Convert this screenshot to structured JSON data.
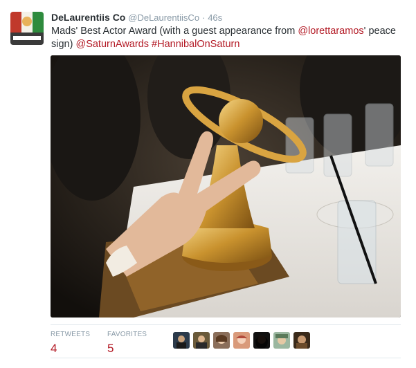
{
  "tweet": {
    "author_name": "DeLaurentiis Co",
    "author_handle": "@DeLaurentiisCo",
    "separator": "·",
    "timestamp": "46s",
    "text_part1": "Mads' Best Actor Award (with a guest appearance from ",
    "mention": "@lorettaramos",
    "text_part2": "' peace sign) ",
    "hashtag_saturn": "@SaturnAwards",
    "hashtag_hannibal": "#HannibalOnSaturn",
    "photo_icon": "saturn-award-photo"
  },
  "stats": {
    "retweets_label": "RETWEETS",
    "retweets_count": "4",
    "favorites_label": "FAVORITES",
    "favorites_count": "5"
  },
  "favoriters": [
    {
      "icon": "user-avatar-1"
    },
    {
      "icon": "user-avatar-2"
    },
    {
      "icon": "user-avatar-3"
    },
    {
      "icon": "user-avatar-4"
    },
    {
      "icon": "user-avatar-5"
    },
    {
      "icon": "user-avatar-6"
    },
    {
      "icon": "user-avatar-7"
    }
  ],
  "colors": {
    "link": "#b31a25",
    "muted": "#8899a6",
    "text": "#292f33",
    "divider": "#e1e8ed"
  }
}
